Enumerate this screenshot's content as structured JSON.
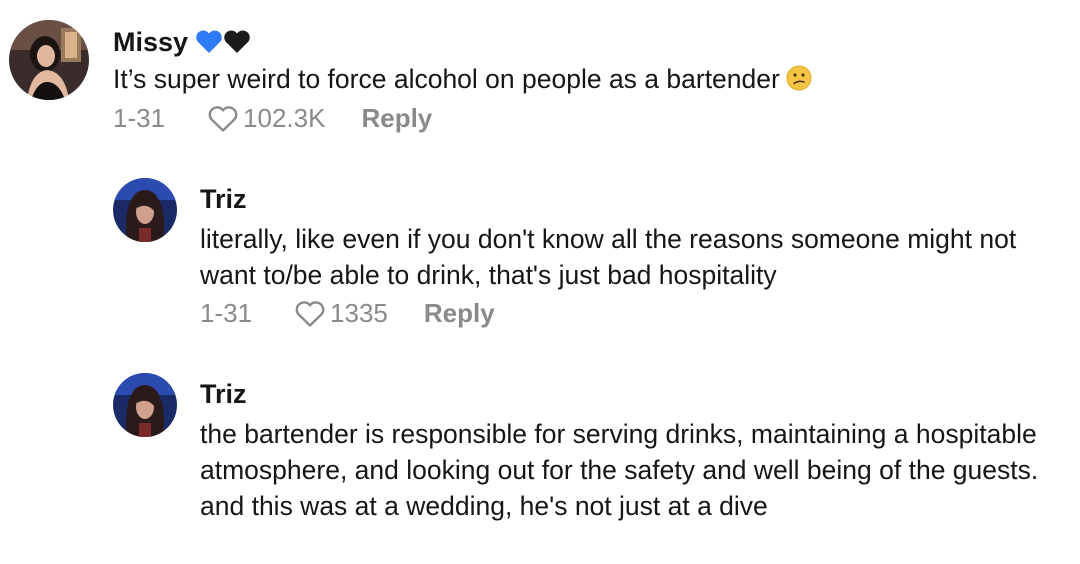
{
  "comments": [
    {
      "author": "Missy",
      "author_hearts": [
        "blue-heart",
        "black-heart"
      ],
      "text": "It’s super weird to force alcohol on people as a bartender",
      "emoji": "confused-face",
      "date": "1-31",
      "likes": "102.3K",
      "reply_label": "Reply"
    },
    {
      "author": "Triz",
      "text": "literally, like even if you don't know all the reasons someone might not want to/be able to drink, that's just bad hospitality",
      "date": "1-31",
      "likes": "1335",
      "reply_label": "Reply"
    },
    {
      "author": "Triz",
      "text": "the bartender is responsible for serving drinks, maintaining a hospitable atmosphere, and looking out for the safety and well being of the guests. and this was at a wedding, he's not just at a dive"
    }
  ],
  "colors": {
    "text": "#161616",
    "meta": "#8a8a8a",
    "blue_heart": "#2f7bf5",
    "black_heart": "#1b1b1b"
  }
}
